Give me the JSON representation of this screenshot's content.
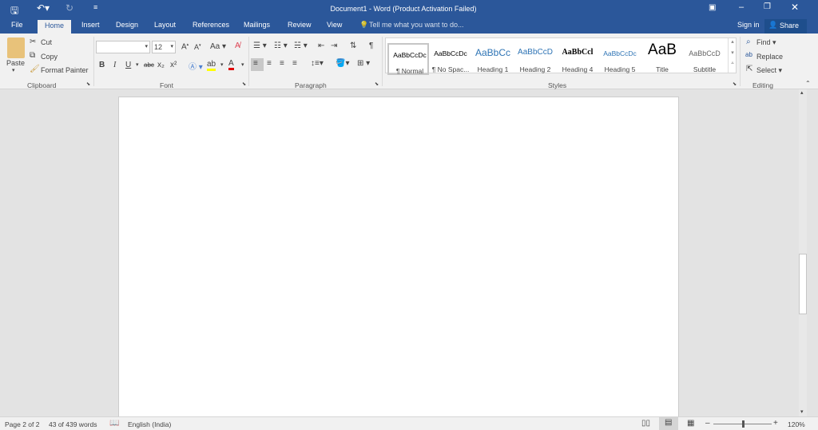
{
  "titlebar": {
    "title": "Document1 - Word (Product Activation Failed)",
    "save_icon": "save-icon",
    "undo_icon": "undo-icon",
    "redo_icon": "redo-icon"
  },
  "tabs": [
    "File",
    "Home",
    "Insert",
    "Design",
    "Layout",
    "References",
    "Mailings",
    "Review",
    "View"
  ],
  "tell_me": "Tell me what you want to do...",
  "sign_in": "Sign in",
  "share": "Share",
  "clipboard": {
    "paste": "Paste",
    "cut": "Cut",
    "copy": "Copy",
    "format_painter": "Format Painter",
    "label": "Clipboard"
  },
  "font": {
    "name": "",
    "size": "12",
    "label": "Font",
    "bold": "B",
    "italic": "I",
    "underline": "U",
    "strike": "abc",
    "sub": "x₂",
    "sup": "x²",
    "grow": "A",
    "shrink": "A",
    "case": "Aa",
    "highlight_color": "#ffff00",
    "font_color": "#e00000"
  },
  "paragraph": {
    "label": "Paragraph",
    "pilcrow": "¶"
  },
  "styles": {
    "label": "Styles",
    "items": [
      {
        "preview": "AaBbCcDc",
        "name": "¶ Normal"
      },
      {
        "preview": "AaBbCcDc",
        "name": "¶ No Spac..."
      },
      {
        "preview": "AaBbCc",
        "name": "Heading 1"
      },
      {
        "preview": "AaBbCcD",
        "name": "Heading 2"
      },
      {
        "preview": "AaBbCcl",
        "name": "Heading 4"
      },
      {
        "preview": "AaBbCcDc",
        "name": "Heading 5"
      },
      {
        "preview": "AaB",
        "name": "Title"
      },
      {
        "preview": "AaBbCcD",
        "name": "Subtitle"
      }
    ]
  },
  "editing": {
    "find": "Find",
    "replace": "Replace",
    "select": "Select",
    "label": "Editing"
  },
  "status": {
    "page": "Page 2 of 2",
    "words": "43 of 439 words",
    "language": "English (India)",
    "zoom": "120%",
    "zoom_level": 120
  },
  "colors": {
    "brand": "#2b579a"
  }
}
